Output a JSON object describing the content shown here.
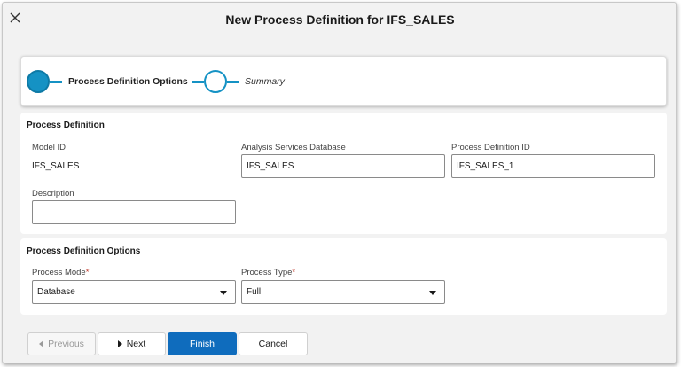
{
  "dialog": {
    "title": "New Process Definition for IFS_SALES",
    "close_icon": "close-icon"
  },
  "wizard": {
    "steps": [
      {
        "label": "Process Definition Options",
        "state": "active"
      },
      {
        "label": "Summary",
        "state": "pending"
      }
    ],
    "accent_color": "#1592c4"
  },
  "process_definition": {
    "section_title": "Process Definition",
    "model_id_label": "Model ID",
    "model_id_value": "IFS_SALES",
    "analysis_db_label": "Analysis Services Database",
    "analysis_db_value": "IFS_SALES",
    "process_def_id_label": "Process Definition ID",
    "process_def_id_value": "IFS_SALES_1",
    "description_label": "Description",
    "description_value": ""
  },
  "process_options": {
    "section_title": "Process Definition Options",
    "mode_label": "Process Mode",
    "mode_value": "Database",
    "type_label": "Process Type",
    "type_value": "Full",
    "required_marker": "*"
  },
  "footer": {
    "previous_label": "Previous",
    "next_label": "Next",
    "finish_label": "Finish",
    "cancel_label": "Cancel",
    "primary_color": "#0f6cbd"
  }
}
